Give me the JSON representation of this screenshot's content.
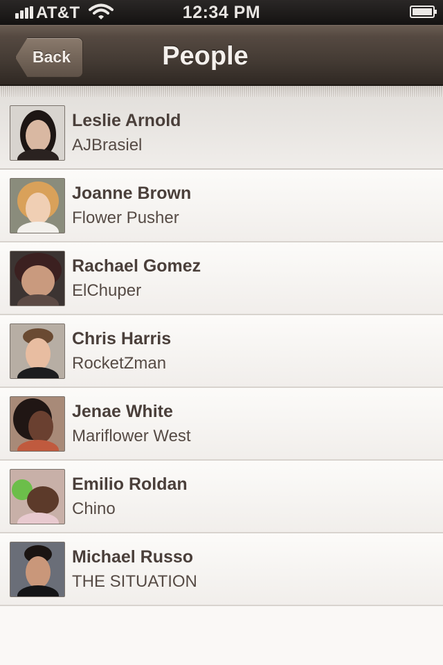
{
  "status_bar": {
    "carrier": "AT&T",
    "time": "12:34 PM"
  },
  "nav": {
    "back_label": "Back",
    "title": "People"
  },
  "people": [
    {
      "name": "Leslie Arnold",
      "handle": "AJBrasiel",
      "selected": true
    },
    {
      "name": "Joanne Brown",
      "handle": "Flower Pusher",
      "selected": false
    },
    {
      "name": "Rachael Gomez",
      "handle": "ElChuper",
      "selected": false
    },
    {
      "name": "Chris Harris",
      "handle": "RocketZman",
      "selected": false
    },
    {
      "name": "Jenae White",
      "handle": "Mariflower West",
      "selected": false
    },
    {
      "name": "Emilio Roldan",
      "handle": "Chino",
      "selected": false
    },
    {
      "name": "Michael Russo",
      "handle": "THE SITUATION",
      "selected": false
    }
  ],
  "colors": {
    "nav_bar": "#4a3f37",
    "name_text": "#4a3f3a",
    "handle_text": "#564b45",
    "list_bg": "#faf8f6"
  },
  "icons": [
    "signal-bars-icon",
    "wifi-icon",
    "battery-icon",
    "back-chevron-icon"
  ]
}
